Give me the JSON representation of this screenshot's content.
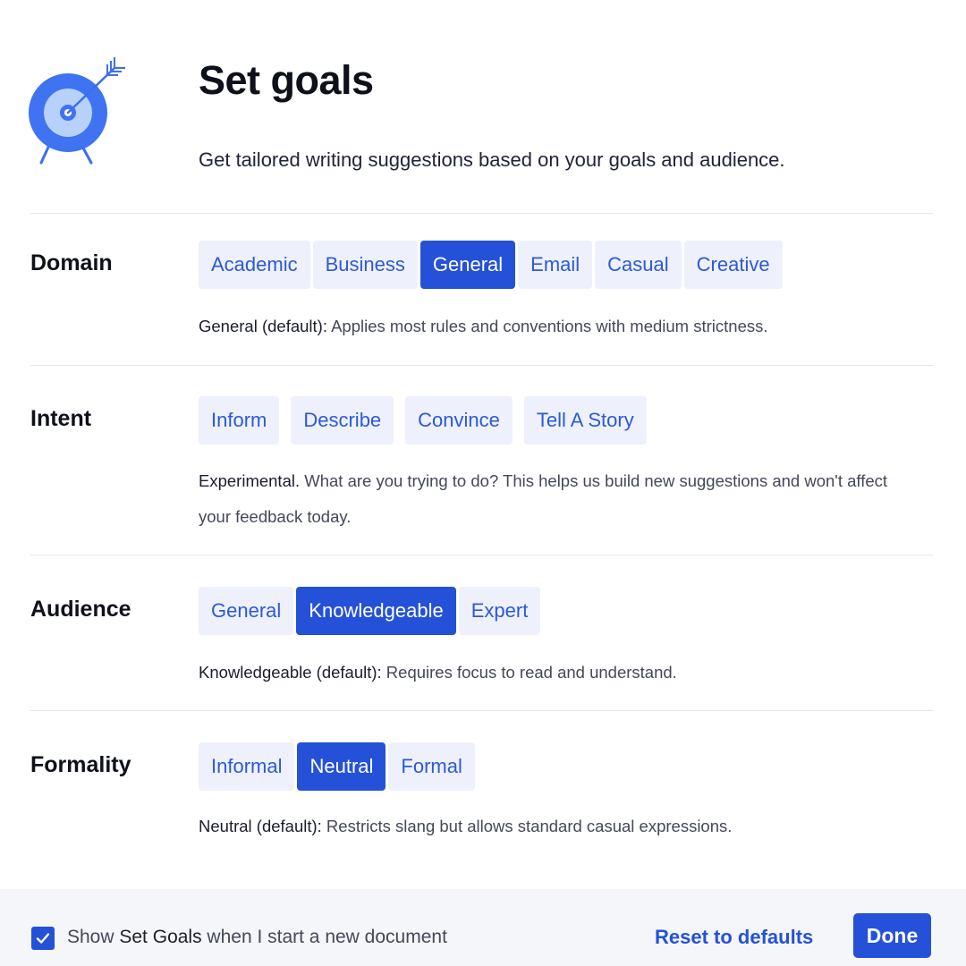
{
  "header": {
    "title": "Set goals",
    "subtitle": "Get tailored writing suggestions based on your goals and audience.",
    "icon": "target-with-arrow-icon"
  },
  "colors": {
    "accent": "#2451d8",
    "option_bg": "#eef1fb",
    "footer_bg": "#f5f6fa"
  },
  "domain": {
    "label": "Domain",
    "options": [
      "Academic",
      "Business",
      "General",
      "Email",
      "Casual",
      "Creative"
    ],
    "selected": "General",
    "desc_strong": "General (default):",
    "desc_rest": " Applies most rules and conventions with medium strictness."
  },
  "intent": {
    "label": "Intent",
    "options": [
      "Inform",
      "Describe",
      "Convince",
      "Tell A Story"
    ],
    "selected": "",
    "desc_strong": "Experimental.",
    "desc_rest": " What are you trying to do? This helps us build new suggestions and won't affect your feedback today."
  },
  "audience": {
    "label": "Audience",
    "options": [
      "General",
      "Knowledgeable",
      "Expert"
    ],
    "selected": "Knowledgeable",
    "desc_strong": "Knowledgeable (default):",
    "desc_rest": " Requires focus to read and understand."
  },
  "formality": {
    "label": "Formality",
    "options": [
      "Informal",
      "Neutral",
      "Formal"
    ],
    "selected": "Neutral",
    "desc_strong": "Neutral (default):",
    "desc_rest": " Restricts slang but allows standard casual expressions."
  },
  "footer": {
    "checkbox_checked": true,
    "show_pre": "Show ",
    "show_em": "Set Goals",
    "show_post": " when I start a new document",
    "reset_label": "Reset to defaults",
    "done_label": "Done"
  }
}
